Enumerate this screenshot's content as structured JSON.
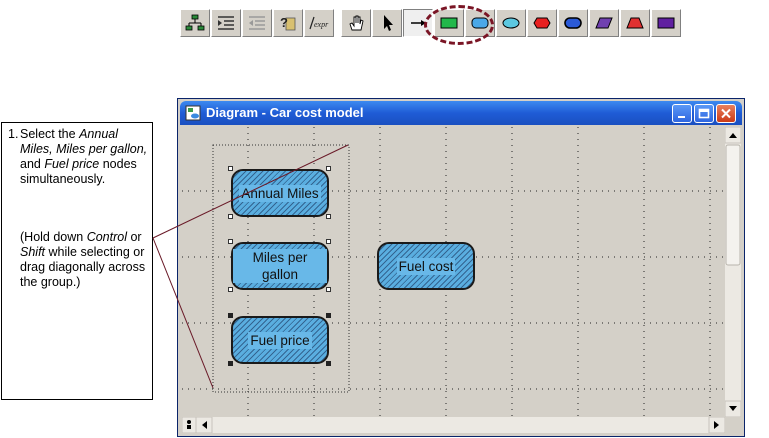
{
  "toolbar": {
    "buttons": [
      {
        "name": "hierarchy-icon"
      },
      {
        "name": "indent-outline-icon"
      },
      {
        "name": "outdent-outline-icon"
      },
      {
        "name": "help-object-icon"
      },
      {
        "name": "expression-icon",
        "label": "expr"
      },
      {
        "name": "hand-browse-icon"
      },
      {
        "name": "pointer-arrow-icon"
      },
      {
        "name": "draw-arrow-icon",
        "selected": true
      },
      {
        "name": "decision-node-icon",
        "color": "#22b84a"
      },
      {
        "name": "chance-node-icon",
        "color": "#4aa8e8"
      },
      {
        "name": "variable-node-icon",
        "color": "#5cc8e0"
      },
      {
        "name": "objective-node-icon",
        "color": "#e82020"
      },
      {
        "name": "module-node-icon",
        "color": "#2a5ad8"
      },
      {
        "name": "index-node-icon",
        "color": "#7040b0"
      },
      {
        "name": "constant-node-icon",
        "color": "#e03030"
      },
      {
        "name": "library-node-icon",
        "color": "#6020a0"
      }
    ]
  },
  "callout": {
    "step_number": "1.",
    "step_text_1": "Select the ",
    "step_em_1": "Annual Miles, Miles per gallon,",
    "step_text_2": " and ",
    "step_em_2": "Fuel price",
    "step_text_3": " nodes simultaneously.",
    "hint_text_1": "(Hold down ",
    "hint_em_1": "Control",
    "hint_text_2": " or ",
    "hint_em_2": "Shift",
    "hint_text_3": " while selecting or drag diagonally across the group.)"
  },
  "window": {
    "title": "Diagram - Car cost model",
    "nodes": [
      {
        "id": "annual-miles",
        "label": "Annual Miles",
        "selected": true
      },
      {
        "id": "miles-per-gallon",
        "label": "Miles per gallon",
        "selected": true
      },
      {
        "id": "fuel-price",
        "label": "Fuel price",
        "selected": true
      },
      {
        "id": "fuel-cost",
        "label": "Fuel cost",
        "selected": false
      }
    ]
  },
  "colors": {
    "node_fill": "#5aaee0",
    "titlebar": "#1f5cd6",
    "highlight": "#7a1525"
  }
}
